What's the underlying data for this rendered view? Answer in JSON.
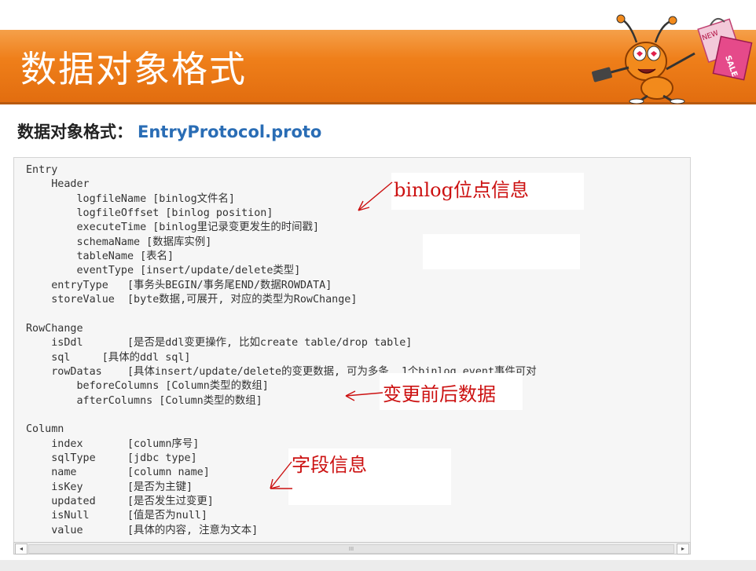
{
  "slide": {
    "title": "数据对象格式",
    "subtitle_label": "数据对象格式：",
    "subtitle_file": "EntryProtocol.proto",
    "mascot_bag_texts": [
      "NEW",
      "SALE"
    ]
  },
  "code": {
    "lines": [
      "Entry",
      "    Header",
      "        logfileName [binlog文件名]",
      "        logfileOffset [binlog position]",
      "        executeTime [binlog里记录变更发生的时间戳]",
      "        schemaName [数据库实例]",
      "        tableName [表名]",
      "        eventType [insert/update/delete类型]",
      "    entryType   [事务头BEGIN/事务尾END/数据ROWDATA]",
      "    storeValue  [byte数据,可展开, 对应的类型为RowChange]",
      "",
      "RowChange",
      "    isDdl       [是否是ddl变更操作, 比如create table/drop table]",
      "    sql     [具体的ddl sql]",
      "    rowDatas    [具体insert/update/delete的变更数据, 可为多条, 1个binlog event事件可对",
      "        beforeColumns [Column类型的数组]",
      "        afterColumns [Column类型的数组]",
      "",
      "Column",
      "    index       [column序号]",
      "    sqlType     [jdbc type]",
      "    name        [column name]",
      "    isKey       [是否为主键]",
      "    updated     [是否发生过变更]",
      "    isNull      [值是否为null]",
      "    value       [具体的内容, 注意为文本]"
    ]
  },
  "annotations": {
    "binlog_position": "binlog位点信息",
    "before_after": "变更前后数据",
    "field_info": "字段信息"
  },
  "scrollbar": {
    "left_arrow": "◂",
    "right_arrow": "▸",
    "thumb_grip": "III"
  },
  "colors": {
    "title_bar": "#ef7f1a",
    "annotation": "#cc1111",
    "file_name": "#2a6db5"
  }
}
